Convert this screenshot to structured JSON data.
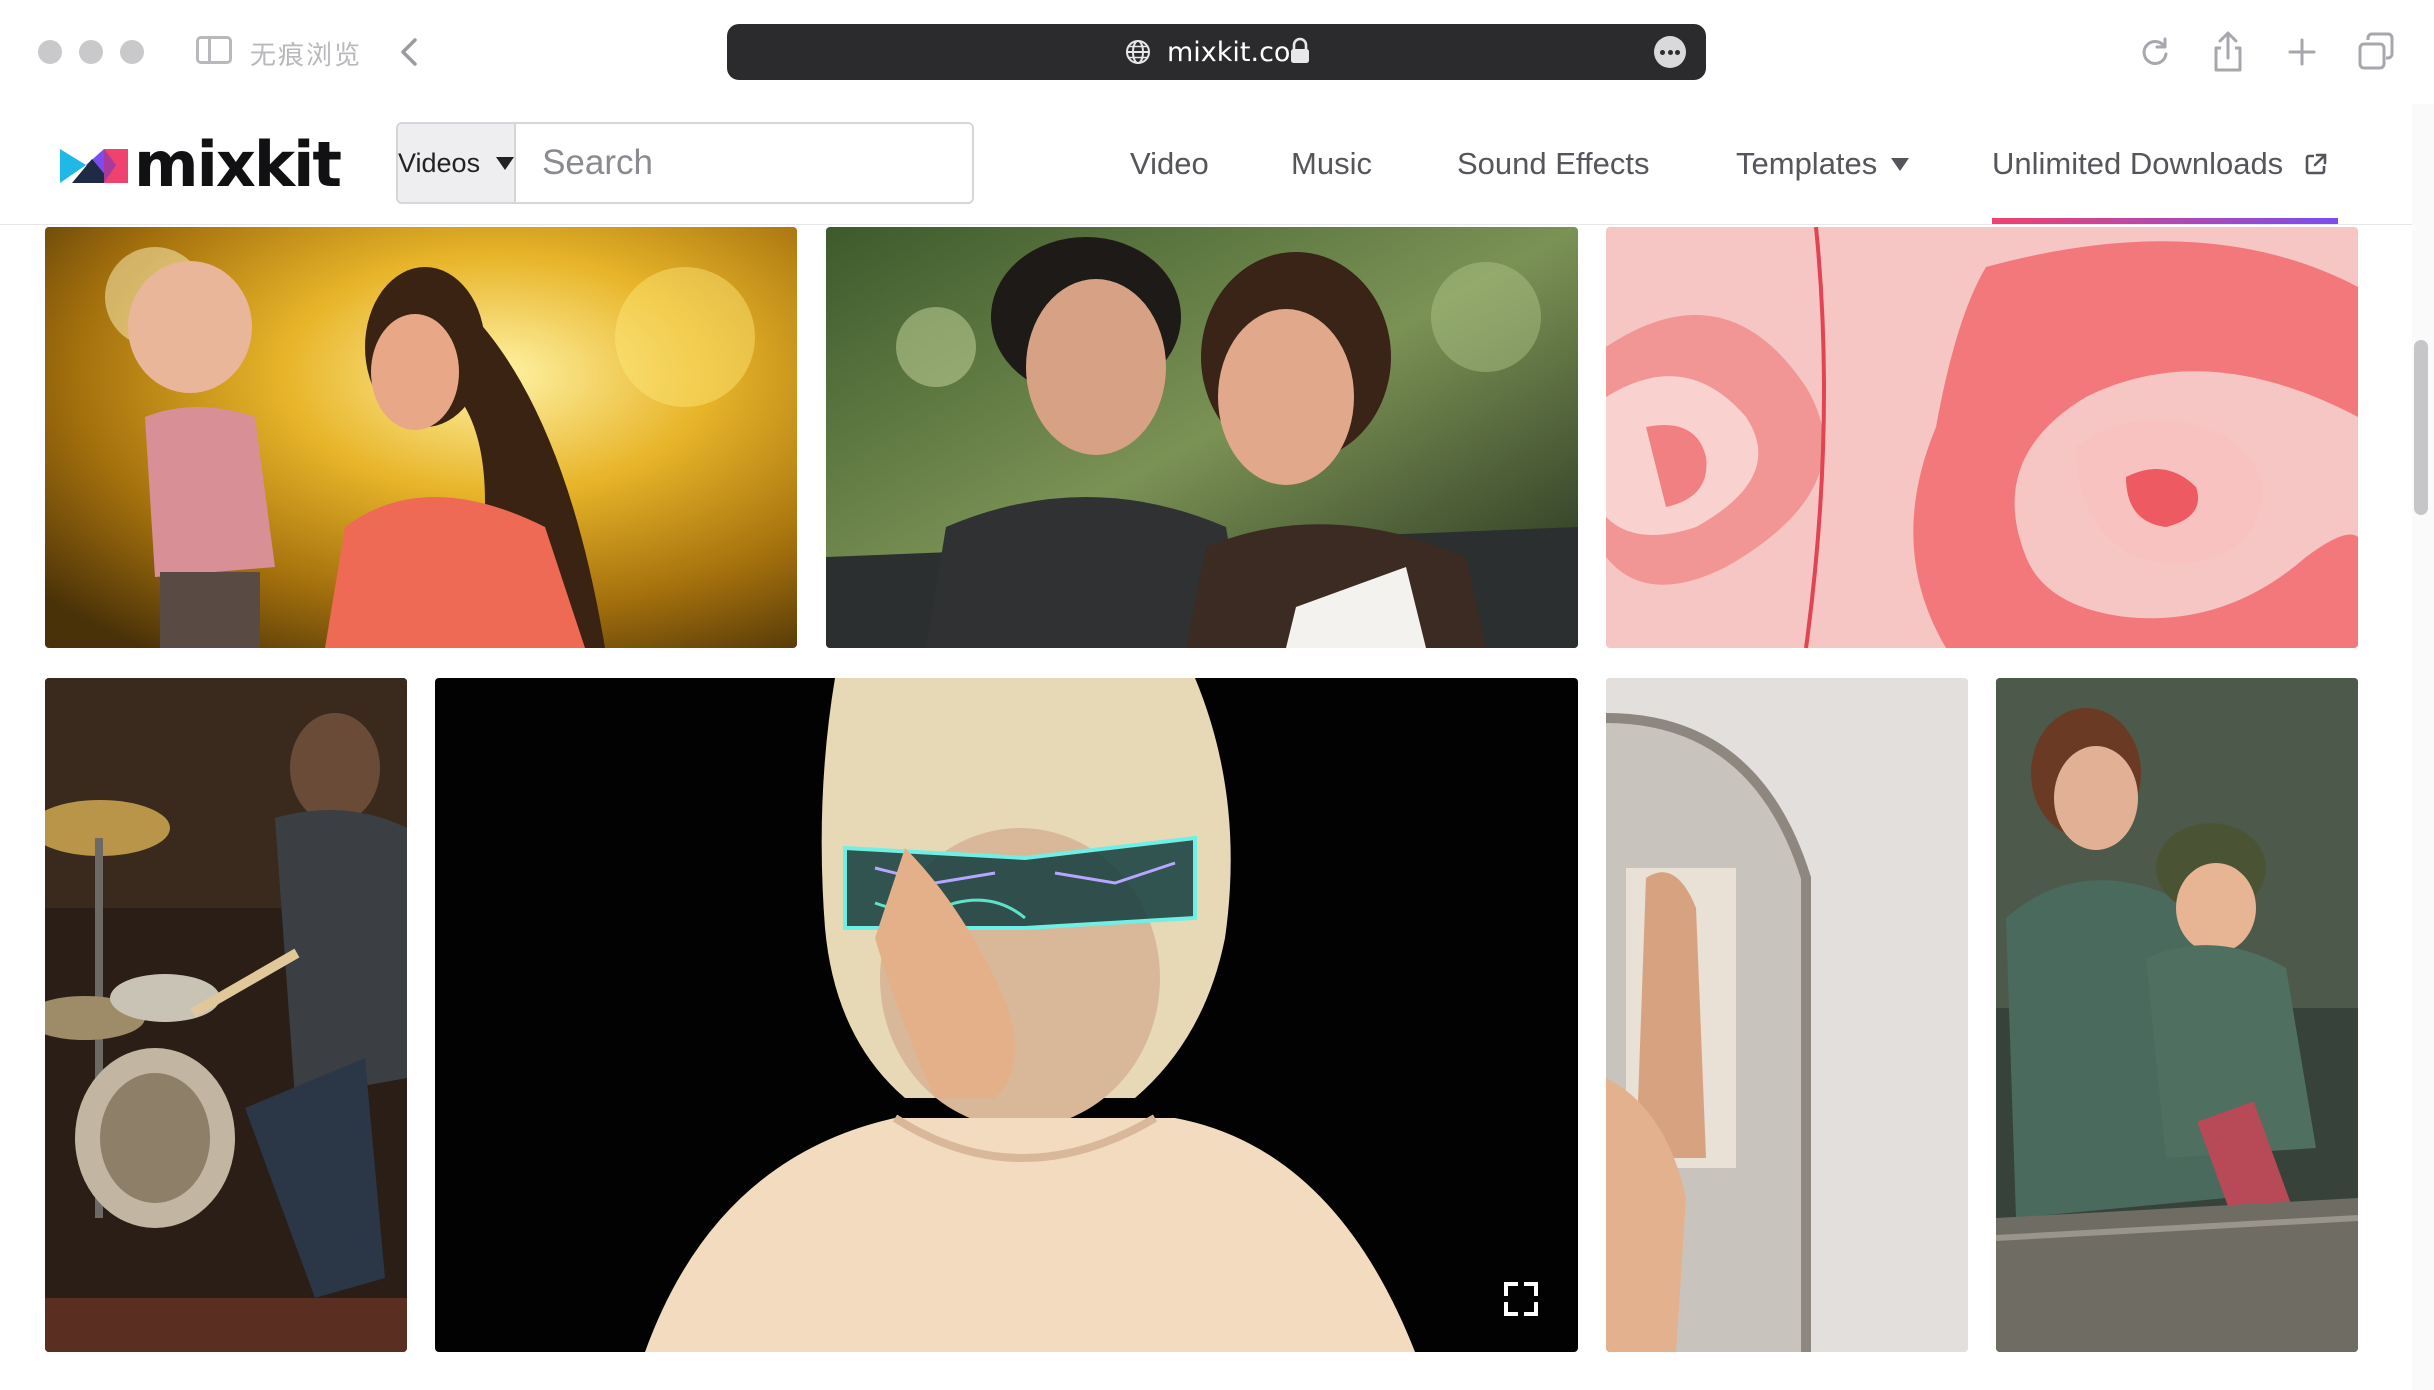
{
  "browser": {
    "private_label": "无痕浏览",
    "url": "mixkit.co"
  },
  "site": {
    "logo_text": "mixkit",
    "search": {
      "type_selected": "Videos",
      "placeholder": "Search"
    },
    "nav": {
      "video": "Video",
      "music": "Music",
      "sound_effects": "Sound Effects",
      "templates": "Templates",
      "unlimited_downloads": "Unlimited Downloads"
    },
    "accent_gradient": [
      "#f0426e",
      "#7b4cf0"
    ]
  },
  "videos": [
    {
      "subject": "mother-and-baby-autumn"
    },
    {
      "subject": "two-women-smiling-park"
    },
    {
      "subject": "pink-marble-swirl"
    },
    {
      "subject": "drummer-playing"
    },
    {
      "subject": "woman-with-neon-glasses"
    },
    {
      "subject": "mirror-room"
    },
    {
      "subject": "mother-and-child-nature"
    }
  ]
}
